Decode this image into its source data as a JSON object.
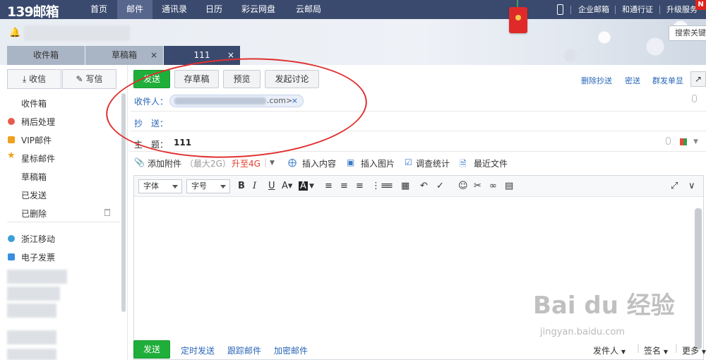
{
  "topnav": {
    "logo": "139邮箱",
    "items": [
      "首页",
      "邮件",
      "通讯录",
      "日历",
      "彩云网盘",
      "云邮局"
    ],
    "active_index": 1,
    "right_links": [
      "企业邮箱",
      "和通行证",
      "升级服务"
    ],
    "badge": "N"
  },
  "header": {
    "search_placeholder": "搜索关键"
  },
  "tabs": [
    {
      "label": "收件箱",
      "closable": false
    },
    {
      "label": "草稿箱",
      "closable": true,
      "close": "×"
    },
    {
      "label": "111",
      "closable": true,
      "close": "×",
      "active": true
    }
  ],
  "sidebar": {
    "receive_label": "收信",
    "compose_label": "写信",
    "folders": [
      {
        "label": "收件箱",
        "icon": "none"
      },
      {
        "label": "稍后处理",
        "icon": "clock-icon",
        "color": "#e85a4f"
      },
      {
        "label": "VIP邮件",
        "icon": "vip-icon",
        "color": "#f0a020"
      },
      {
        "label": "星标邮件",
        "icon": "star-icon",
        "color": "#f0a020"
      },
      {
        "label": "草稿箱",
        "icon": "none"
      },
      {
        "label": "已发送",
        "icon": "none"
      },
      {
        "label": "已删除",
        "icon": "none"
      }
    ],
    "services": [
      {
        "label": "浙江移动",
        "icon": "china-mobile-icon"
      },
      {
        "label": "电子发票",
        "icon": "invoice-icon"
      }
    ]
  },
  "compose": {
    "send_label": "发送",
    "save_draft_label": "存草稿",
    "preview_label": "预览",
    "discuss_label": "发起讨论",
    "right_links": [
      "删除抄送",
      "密送",
      "群发单显"
    ],
    "to_label": "收件人：",
    "recipient_domain": ".com>",
    "recipient_close": "×",
    "cc_label": "抄　送：",
    "subject_label": "主　题：",
    "subject_value": "111",
    "attach_label": "添加附件",
    "attach_limit": "（最大2G）",
    "attach_upgrade": "升至4G",
    "insert_content": "插入内容",
    "insert_image": "插入图片",
    "survey": "调查统计",
    "recent_files": "最近文件"
  },
  "editor": {
    "font_label": "字体",
    "size_label": "字号"
  },
  "bottom": {
    "send_label": "发送",
    "links": [
      "定时发送",
      "跟踪邮件",
      "加密邮件"
    ],
    "sender_label": "发件人",
    "signature_label": "签名",
    "more_label": "更多"
  },
  "watermark": {
    "main": "Bai du 经验",
    "sub": "jingyan.baidu.com"
  },
  "colors": {
    "nav": "#3a4a6e",
    "send": "#1fae3a",
    "link": "#2866b8"
  }
}
